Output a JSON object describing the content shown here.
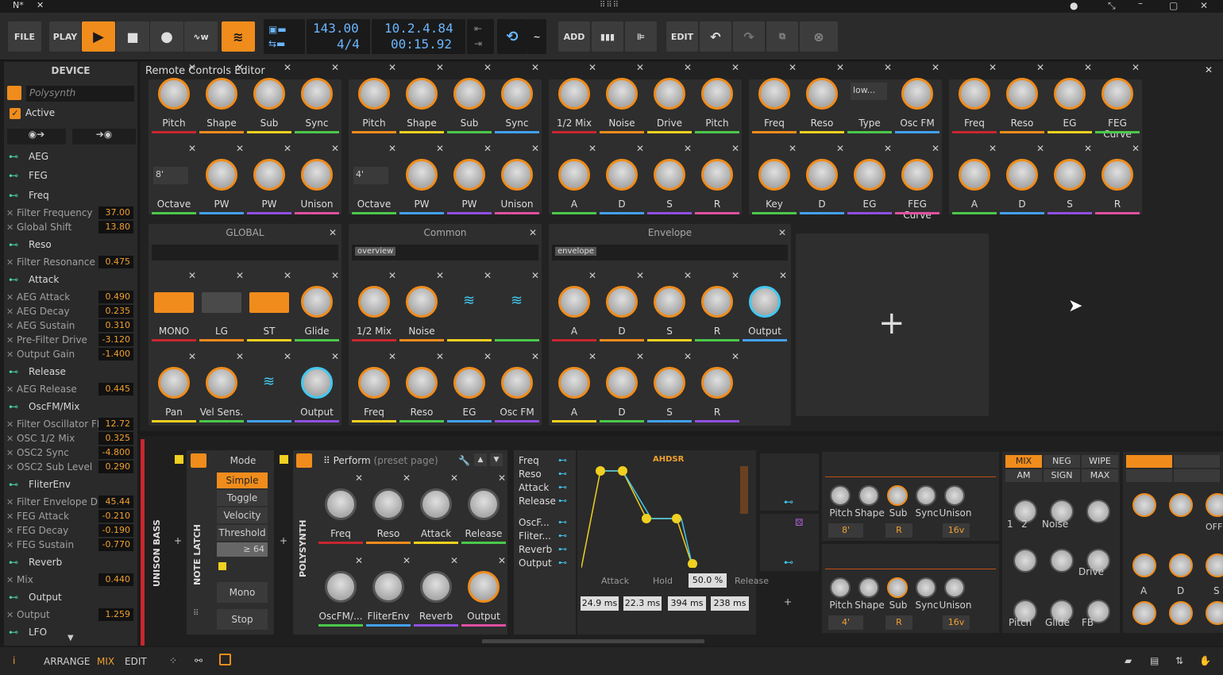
{
  "window": {
    "logo": "N*",
    "close": "✕"
  },
  "transport": {
    "file": "FILE",
    "play": "PLAY",
    "tempo": "143.00",
    "signature": "4/4",
    "position": "10.2.4.84",
    "time": "00:15.92",
    "add": "ADD",
    "edit": "EDIT"
  },
  "sidebar": {
    "title": "DEVICE",
    "preset_placeholder": "Polysynth",
    "active": "Active",
    "rows": [
      {
        "kind": "group",
        "label": "AEG"
      },
      {
        "kind": "group",
        "label": "FEG"
      },
      {
        "kind": "group",
        "label": "Freq"
      },
      {
        "kind": "param",
        "label": "Filter Frequency",
        "value": "37.00"
      },
      {
        "kind": "param",
        "label": "Global Shift",
        "value": "13.80"
      },
      {
        "kind": "group",
        "label": "Reso"
      },
      {
        "kind": "param",
        "label": "Filter Resonance",
        "value": "0.475"
      },
      {
        "kind": "group",
        "label": "Attack"
      },
      {
        "kind": "param",
        "label": "AEG Attack",
        "value": "0.490"
      },
      {
        "kind": "param",
        "label": "AEG Decay",
        "value": "0.235"
      },
      {
        "kind": "param",
        "label": "AEG Sustain",
        "value": "0.310"
      },
      {
        "kind": "param",
        "label": "Pre-Filter Drive",
        "value": "-3.120"
      },
      {
        "kind": "param",
        "label": "Output Gain",
        "value": "-1.400"
      },
      {
        "kind": "group",
        "label": "Release"
      },
      {
        "kind": "param",
        "label": "AEG Release",
        "value": "0.445"
      },
      {
        "kind": "group",
        "label": "OscFM/Mix"
      },
      {
        "kind": "param",
        "label": "Filter Oscillator FM",
        "value": "12.72"
      },
      {
        "kind": "param",
        "label": "OSC 1/2 Mix",
        "value": "0.325"
      },
      {
        "kind": "param",
        "label": "OSC2 Sync",
        "value": "-4.800"
      },
      {
        "kind": "param",
        "label": "OSC2 Sub Level",
        "value": "0.290"
      },
      {
        "kind": "group",
        "label": "FliterEnv"
      },
      {
        "kind": "param",
        "label": "Filter Envelope D...",
        "value": "45.44"
      },
      {
        "kind": "param",
        "label": "FEG Attack",
        "value": "-0.210"
      },
      {
        "kind": "param",
        "label": "FEG Decay",
        "value": "-0.190"
      },
      {
        "kind": "param",
        "label": "FEG Sustain",
        "value": "-0.770"
      },
      {
        "kind": "group",
        "label": "Reverb"
      },
      {
        "kind": "param",
        "label": "Mix",
        "value": "0.440"
      },
      {
        "kind": "group",
        "label": "Output"
      },
      {
        "kind": "param",
        "label": "Output",
        "value": "1.259"
      },
      {
        "kind": "group",
        "label": "LFO"
      }
    ]
  },
  "editor": {
    "title": "Remote Controls Editor",
    "top_cards": [
      {
        "r1": [
          "Pitch",
          "Shape",
          "Sub",
          "Sync"
        ],
        "r2": [
          "Octave",
          "PW",
          "PW",
          "Unison"
        ],
        "oct": "8'"
      },
      {
        "r1": [
          "Pitch",
          "Shape",
          "Sub",
          "Sync"
        ],
        "r2": [
          "Octave",
          "PW",
          "PW",
          "Unison"
        ],
        "oct": "4'"
      },
      {
        "r1": [
          "1/2 Mix",
          "Noise",
          "Drive",
          "Pitch"
        ],
        "r2": [
          "A",
          "D",
          "S",
          "R"
        ]
      },
      {
        "r1": [
          "Freq",
          "Reso",
          "Type",
          "Osc FM"
        ],
        "r2": [
          "Key",
          "D",
          "EG",
          "FEG Curve"
        ],
        "type": "low..."
      },
      {
        "r1": [
          "Freq",
          "Reso",
          "EG",
          "FEG Curve"
        ],
        "r2": [
          "A",
          "D",
          "S",
          "R"
        ]
      }
    ],
    "mid_cards": [
      {
        "title": "GLOBAL",
        "tag": "",
        "r1": [
          "MONO",
          "LG",
          "ST",
          "Glide"
        ],
        "r2": [
          "Pan",
          "Vel Sens.",
          "",
          "Output"
        ]
      },
      {
        "title": "Common",
        "tag": "overview",
        "r1": [
          "1/2 Mix",
          "Noise",
          "",
          ""
        ],
        "r2": [
          "Freq",
          "Reso",
          "EG",
          "Osc FM"
        ]
      },
      {
        "title": "Envelope",
        "tag": "envelope",
        "r1": [
          "A",
          "D",
          "S",
          "R",
          "Output"
        ],
        "r2": [
          "A",
          "D",
          "S",
          "R"
        ]
      }
    ]
  },
  "bottom": {
    "track": "UNISON BASS",
    "notelatch": "NOTE LATCH",
    "polysynth": "POLYSYNTH",
    "modes": [
      "Mode",
      "Simple",
      "Toggle",
      "Velocity",
      "Threshold",
      "≥ 64",
      "Mono",
      "Stop"
    ],
    "perform": "Perform",
    "preset_page": "(preset page)",
    "perf_r1": [
      "Freq",
      "Reso",
      "Attack",
      "Release"
    ],
    "perf_r2": [
      "OscFM/...",
      "FliterEnv",
      "Reverb",
      "Output"
    ],
    "list": [
      "Freq",
      "Reso",
      "Attack",
      "Release",
      "OscF...",
      "Fliter...",
      "Reverb",
      "Output"
    ],
    "ahdsr": "AHDSR",
    "env_labels": [
      "Attack",
      "Hold",
      "50.0 %",
      "Release"
    ],
    "env_vals": [
      "24.9 ms",
      "22.3 ms",
      "394 ms",
      "238 ms"
    ],
    "osc_labels": [
      "Pitch",
      "Shape",
      "Sub",
      "Sync",
      "Unison"
    ],
    "osc1": [
      "8'",
      "R",
      "16v"
    ],
    "osc2": [
      "4'",
      "R",
      "16v"
    ],
    "mix_btns": [
      "MIX",
      "NEG",
      "WIPE",
      "AM",
      "SIGN",
      "MAX"
    ],
    "mix_labels": [
      "1",
      "2",
      "Noise",
      "Drive",
      "Pitch",
      "Glide",
      "FB"
    ],
    "adsr": [
      "A",
      "D",
      "S"
    ],
    "off": "OFF"
  },
  "status": {
    "arrange": "ARRANGE",
    "mix": "MIX",
    "edit": "EDIT"
  }
}
